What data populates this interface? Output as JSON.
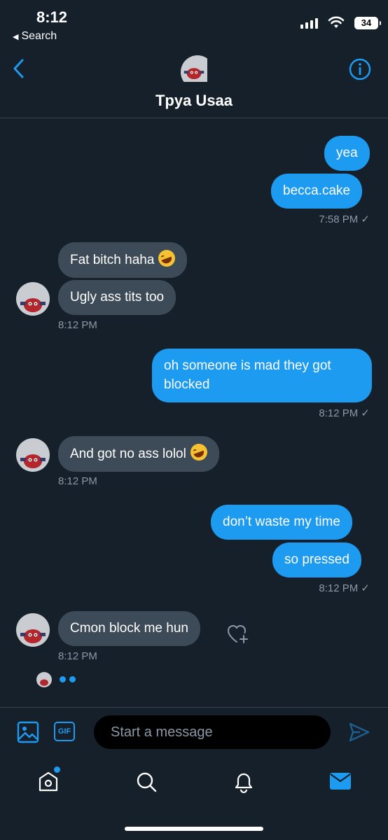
{
  "status_bar": {
    "time": "8:12",
    "back_app": "Search",
    "battery": "34"
  },
  "header": {
    "title": "Tpya Usaa"
  },
  "messages": [
    {
      "id": "m1",
      "dir": "out",
      "text": "yea"
    },
    {
      "id": "m2",
      "dir": "out",
      "text": "becca.cake"
    },
    {
      "id": "t1",
      "dir": "meta-out",
      "text": "7:58 PM ✓"
    },
    {
      "id": "m3",
      "dir": "in",
      "text": "Fat bitch haha"
    },
    {
      "id": "m4",
      "dir": "in",
      "text": "Ugly ass tits too"
    },
    {
      "id": "t2",
      "dir": "meta-in",
      "text": "8:12 PM"
    },
    {
      "id": "m5",
      "dir": "out",
      "text_line1": "oh someone is mad they got",
      "text_line2": "blocked"
    },
    {
      "id": "t3",
      "dir": "meta-out",
      "text": "8:12 PM ✓"
    },
    {
      "id": "m6",
      "dir": "in",
      "text": "And got no ass lolol"
    },
    {
      "id": "t4",
      "dir": "meta-in",
      "text": "8:12 PM"
    },
    {
      "id": "m7",
      "dir": "out",
      "text": "don’t waste my time"
    },
    {
      "id": "m8",
      "dir": "out",
      "text": "so pressed"
    },
    {
      "id": "t5",
      "dir": "meta-out",
      "text": "8:12 PM ✓"
    },
    {
      "id": "m9",
      "dir": "in",
      "text": "Cmon block me hun"
    },
    {
      "id": "t6",
      "dir": "meta-in",
      "text": "8:12 PM"
    }
  ],
  "composer": {
    "placeholder": "Start a message",
    "gif_label": "GIF"
  },
  "icons": {
    "back": "chevron-left-icon",
    "info": "info-icon",
    "image": "image-icon",
    "gif": "gif-icon",
    "send": "send-icon",
    "react": "heart-plus-icon",
    "nav": [
      "home-icon",
      "search-icon",
      "bell-icon",
      "mail-icon"
    ]
  },
  "colors": {
    "accent": "#1d9bf0",
    "background": "#15202b",
    "incoming_bubble": "#3d4a57"
  }
}
